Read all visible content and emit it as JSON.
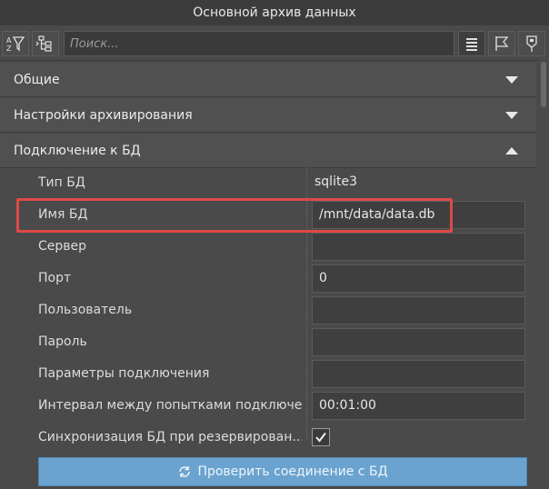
{
  "window": {
    "title": "Основной архив данных"
  },
  "toolbar": {
    "search_placeholder": "Поиск..."
  },
  "sections": [
    {
      "label": "Общие",
      "expanded": false
    },
    {
      "label": "Настройки архивирования",
      "expanded": false
    },
    {
      "label": "Подключение к БД",
      "expanded": true
    }
  ],
  "properties": [
    {
      "label": "Тип БД",
      "value": "sqlite3"
    },
    {
      "label": "Имя БД",
      "value": "/mnt/data/data.db"
    },
    {
      "label": "Сервер",
      "value": ""
    },
    {
      "label": "Порт",
      "value": "0"
    },
    {
      "label": "Пользователь",
      "value": ""
    },
    {
      "label": "Пароль",
      "value": ""
    },
    {
      "label": "Параметры подключения",
      "value": ""
    },
    {
      "label": "Интервал между попытками подключе...",
      "value": "00:01:00"
    },
    {
      "label": "Синхронизация БД при резервирован...",
      "checked": true
    }
  ],
  "actions": {
    "check_connection": "Проверить соединение с БД"
  },
  "colors": {
    "highlight": "#e04848",
    "button": "#6aa3cf"
  }
}
